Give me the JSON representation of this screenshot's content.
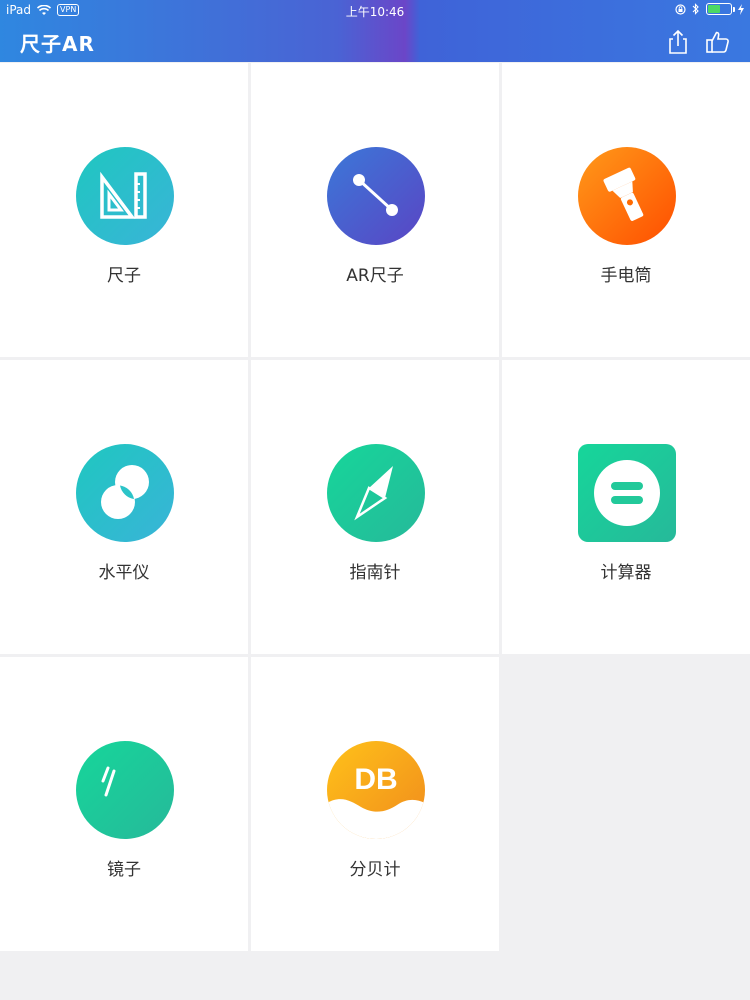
{
  "status_bar": {
    "device": "iPad",
    "vpn": "VPN",
    "time": "上午10:46"
  },
  "header": {
    "title": "尺子AR",
    "share_icon": "share-icon",
    "like_icon": "thumbs-up-icon"
  },
  "tools": [
    {
      "label": "尺子",
      "icon": "ruler-icon",
      "color": "#2cc4c8"
    },
    {
      "label": "AR尺子",
      "icon": "ar-measure-icon",
      "color": "#4a5fd0"
    },
    {
      "label": "手电筒",
      "icon": "flashlight-icon",
      "color": "#ff6a00"
    },
    {
      "label": "水平仪",
      "icon": "level-icon",
      "color": "#2cc4c8"
    },
    {
      "label": "指南针",
      "icon": "compass-icon",
      "color": "#22c99a"
    },
    {
      "label": "计算器",
      "icon": "calculator-icon",
      "color": "#22c99a"
    },
    {
      "label": "镜子",
      "icon": "mirror-icon",
      "color": "#22c99a"
    },
    {
      "label": "分贝计",
      "icon": "decibel-meter-icon",
      "color": "#f5a623",
      "icon_text": "DB"
    }
  ],
  "colors": {
    "header_start": "#2f87e0",
    "header_end": "#3a78e0",
    "background": "#f0f0f2",
    "tile": "#ffffff",
    "label_text": "#333333"
  }
}
